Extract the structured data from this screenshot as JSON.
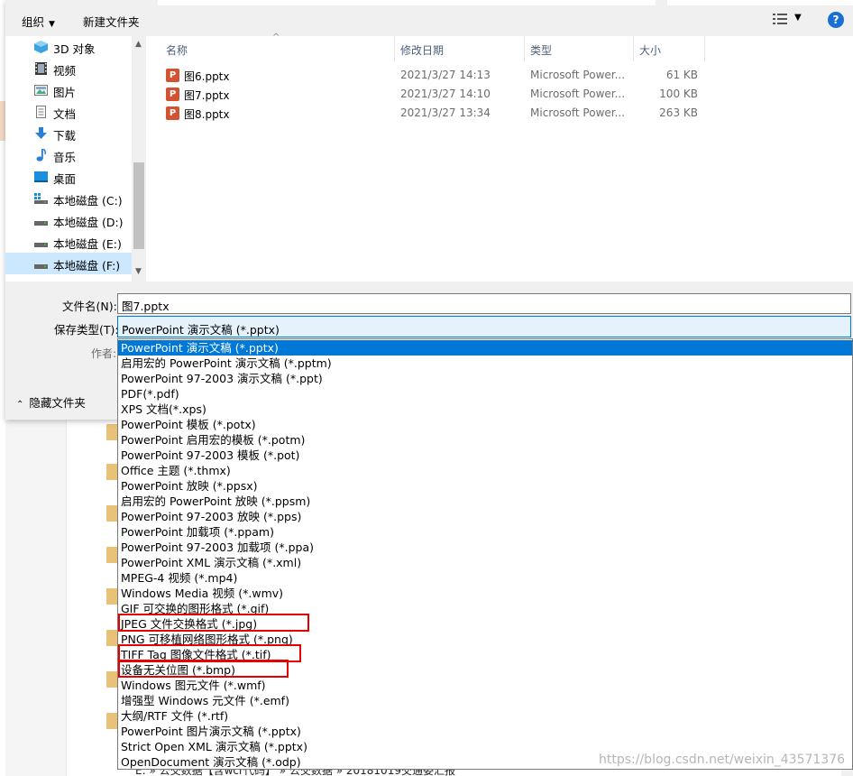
{
  "toolbar": {
    "organize": "组织",
    "new_folder": "新建文件夹",
    "help": "?"
  },
  "nav": {
    "items": [
      {
        "label": "3D 对象",
        "icon": "3d-objects-icon"
      },
      {
        "label": "视频",
        "icon": "video-icon"
      },
      {
        "label": "图片",
        "icon": "pictures-icon"
      },
      {
        "label": "文档",
        "icon": "documents-icon"
      },
      {
        "label": "下载",
        "icon": "downloads-icon"
      },
      {
        "label": "音乐",
        "icon": "music-icon"
      },
      {
        "label": "桌面",
        "icon": "desktop-icon"
      },
      {
        "label": "本地磁盘 (C:)",
        "icon": "drive-icon"
      },
      {
        "label": "本地磁盘 (D:)",
        "icon": "drive-icon"
      },
      {
        "label": "本地磁盘 (E:)",
        "icon": "drive-icon"
      },
      {
        "label": "本地磁盘 (F:)",
        "icon": "drive-icon"
      }
    ],
    "selected_index": 10
  },
  "files": {
    "columns": [
      "名称",
      "修改日期",
      "类型",
      "大小"
    ],
    "rows": [
      {
        "name": "图6.pptx",
        "date": "2021/3/27 14:13",
        "type": "Microsoft Power...",
        "size": "61 KB"
      },
      {
        "name": "图7.pptx",
        "date": "2021/3/27 14:10",
        "type": "Microsoft Power...",
        "size": "100 KB"
      },
      {
        "name": "图8.pptx",
        "date": "2021/3/27 13:34",
        "type": "Microsoft Power...",
        "size": "263 KB"
      }
    ]
  },
  "form": {
    "filename_label": "文件名(N):",
    "filename_value": "图7.pptx",
    "savetype_label": "保存类型(T):",
    "savetype_value": "PowerPoint 演示文稿 (*.pptx)",
    "author_label": "作者:",
    "hide_folders": "隐藏文件夹"
  },
  "dropdown": {
    "options": [
      "PowerPoint 演示文稿 (*.pptx)",
      "启用宏的 PowerPoint 演示文稿 (*.pptm)",
      "PowerPoint 97-2003 演示文稿 (*.ppt)",
      "PDF(*.pdf)",
      "XPS 文档(*.xps)",
      "PowerPoint 模板 (*.potx)",
      "PowerPoint 启用宏的模板 (*.potm)",
      "PowerPoint 97-2003 模板 (*.pot)",
      "Office 主题 (*.thmx)",
      "PowerPoint 放映 (*.ppsx)",
      "启用宏的 PowerPoint 放映 (*.ppsm)",
      "PowerPoint 97-2003 放映 (*.pps)",
      "PowerPoint 加载项 (*.ppam)",
      "PowerPoint 97-2003 加载项 (*.ppa)",
      "PowerPoint XML 演示文稿 (*.xml)",
      "MPEG-4 视频 (*.mp4)",
      "Windows Media 视频 (*.wmv)",
      "GIF 可交换的图形格式 (*.gif)",
      "JPEG 文件交换格式 (*.jpg)",
      "PNG 可移植网络图形格式 (*.png)",
      "TIFF Tag 图像文件格式 (*.tif)",
      "设备无关位图 (*.bmp)",
      "Windows 图元文件 (*.wmf)",
      "增强型 Windows 元文件 (*.emf)",
      "大纲/RTF 文件 (*.rtf)",
      "PowerPoint 图片演示文稿 (*.pptx)",
      "Strict Open XML 演示文稿 (*.pptx)",
      "OpenDocument 演示文稿 (*.odp)"
    ],
    "active_index": 0,
    "highlighted": [
      "JPEG 文件交换格式 (*.jpg)",
      "TIFF Tag 图像文件格式 (*.tif)",
      "设备无关位图 (*.bmp)"
    ],
    "highlight_color": "#e60000"
  },
  "background": {
    "path_text": "E: » 公交数据【含wcr代码】 » 公交数据 » 20181019交通委汇报"
  },
  "watermark": "https://blog.csdn.net/weixin_43571376",
  "colors": {
    "accent": "#0078d7",
    "selection": "#cce8ff",
    "ppt_icon": "#d35230"
  }
}
